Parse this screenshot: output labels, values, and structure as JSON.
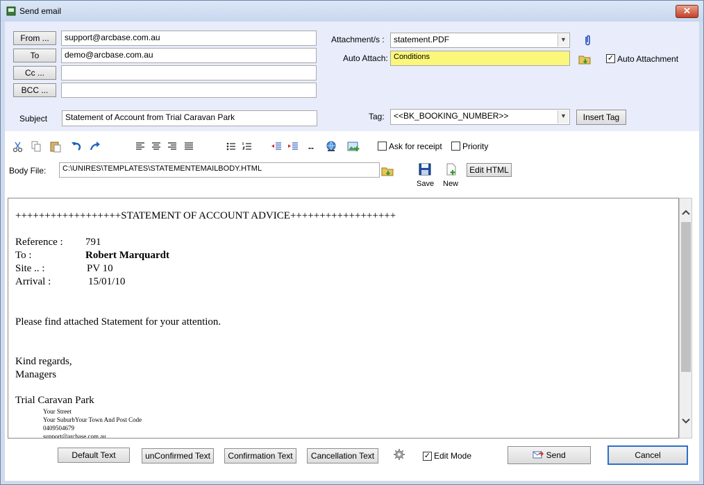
{
  "window": {
    "title": "Send email",
    "close_label": "✕"
  },
  "address": {
    "from_label": "From ...",
    "from_value": "support@arcbase.com.au",
    "to_label": "To",
    "to_value": "demo@arcbase.com.au",
    "cc_label": "Cc ...",
    "cc_value": "",
    "bcc_label": "BCC ...",
    "bcc_value": "",
    "subject_label": "Subject",
    "subject_value": "Statement of Account from Trial Caravan Park"
  },
  "attachments": {
    "label": "Attachment/s :",
    "value": "statement.PDF",
    "auto_attach_label": "Auto Attach:",
    "auto_attach_value": "Conditions",
    "auto_attachment_label": "Auto Attachment",
    "auto_attachment_checked": true
  },
  "tag": {
    "label": "Tag:",
    "value": "<<BK_BOOKING_NUMBER>>",
    "insert_label": "Insert Tag"
  },
  "toolbar": {
    "ask_receipt_label": "Ask for receipt",
    "priority_label": "Priority",
    "separator_label": "--"
  },
  "body_file": {
    "label": "Body File:",
    "value": "C:\\UNIRES\\TEMPLATES\\STATEMENTEMAILBODY.HTML",
    "save_label": "Save",
    "new_label": "New",
    "edit_html_label": "Edit HTML"
  },
  "document": {
    "heading": "++++++++++++++++++STATEMENT OF ACCOUNT ADVICE++++++++++++++++++",
    "reference_label": "Reference :",
    "reference_value": "791",
    "to_label": "To       :",
    "to_value": "Robert Marquardt",
    "site_label": "Site ..  :",
    "site_value": "PV 10",
    "arrival_label": "Arrival   :",
    "arrival_value": "15/01/10",
    "message": "Please find attached Statement for your attention.",
    "regards": "Kind regards,",
    "signoff": "Managers",
    "park_name": "Trial Caravan Park",
    "address_lines": [
      "Your Street",
      "Your SuburbYour Town And Post Code",
      "0409504679",
      "support@arcbase.com.au"
    ]
  },
  "footer": {
    "default_text_label": "Default Text",
    "unconfirmed_text_label": "unConfirmed Text",
    "confirmation_text_label": "Confirmation Text",
    "cancellation_text_label": "Cancellation Text",
    "edit_mode_label": "Edit Mode",
    "edit_mode_checked": true,
    "send_label": "Send",
    "cancel_label": "Cancel"
  }
}
